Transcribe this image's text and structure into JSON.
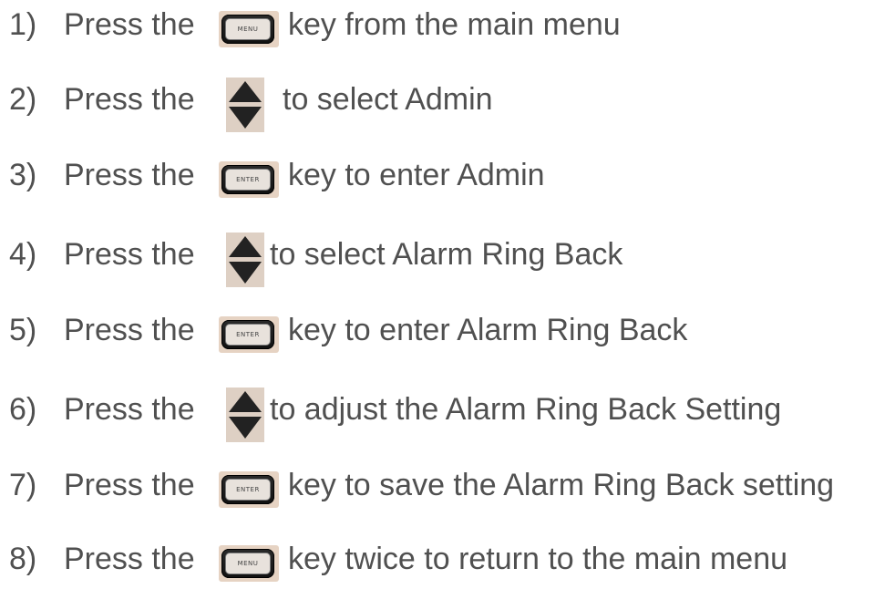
{
  "steps": [
    {
      "num": "1)",
      "lead": "Press the",
      "icon": "menu-key-icon",
      "key_label": "MENU",
      "rest": "key from the main menu"
    },
    {
      "num": "2)",
      "lead": "Press the",
      "icon": "up-down-arrow-keys-icon",
      "key_label": "",
      "rest": "to select Admin"
    },
    {
      "num": "3)",
      "lead": "Press the",
      "icon": "enter-key-icon",
      "key_label": "ENTER",
      "rest": "key to enter Admin"
    },
    {
      "num": "4)",
      "lead": "Press the",
      "icon": "up-down-arrow-keys-icon",
      "key_label": "",
      "rest": "to select Alarm Ring Back"
    },
    {
      "num": "5)",
      "lead": "Press the",
      "icon": "enter-key-icon",
      "key_label": "ENTER",
      "rest": "key to enter Alarm Ring Back"
    },
    {
      "num": "6)",
      "lead": "Press the",
      "icon": "up-down-arrow-keys-icon",
      "key_label": "",
      "rest": "to adjust the Alarm Ring Back Setting"
    },
    {
      "num": "7)",
      "lead": "Press the",
      "icon": "enter-key-icon",
      "key_label": "ENTER",
      "rest": "key to save the Alarm Ring Back setting"
    },
    {
      "num": "8)",
      "lead": "Press the",
      "icon": "menu-key-icon",
      "key_label": "MENU",
      "rest": "key twice to return to the main menu"
    }
  ],
  "colors": {
    "text": "#505050",
    "key_background": "#e6d3c3",
    "key_cap": "#1a1a1a",
    "arrow_background": "#ded0c4"
  }
}
